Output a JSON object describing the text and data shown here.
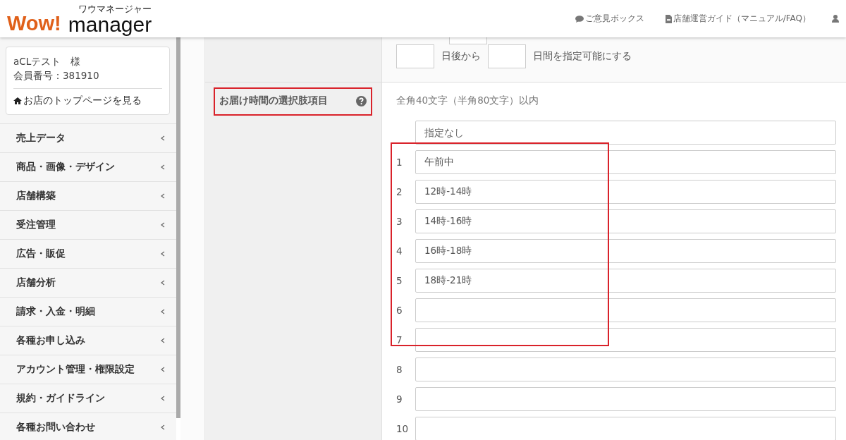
{
  "header": {
    "logo": {
      "brand": "Wow!",
      "name": "manager",
      "ruby": "ワウマネージャー"
    },
    "links": [
      {
        "kind": "feedback",
        "label": "ご意見ボックス"
      },
      {
        "kind": "guide",
        "label": "店舗運営ガイド（マニュアル/FAQ）"
      },
      {
        "kind": "account"
      }
    ]
  },
  "account": {
    "name": "aCLテスト　様",
    "member_no": "会員番号：381910",
    "top_link": "お店のトップページを見る"
  },
  "menu": [
    {
      "label": "売上データ",
      "expanded": false
    },
    {
      "label": "商品・画像・デザイン",
      "expanded": false
    },
    {
      "label": "店舗構築",
      "expanded": false
    },
    {
      "label": "受注管理",
      "expanded": false
    },
    {
      "label": "広告・販促",
      "expanded": false
    },
    {
      "label": "店舗分析",
      "expanded": false
    },
    {
      "label": "請求・入金・明細",
      "expanded": false
    },
    {
      "label": "各種お申し込み",
      "expanded": false
    },
    {
      "label": "アカウント管理・権限設定",
      "expanded": false
    },
    {
      "label": "規約・ガイドライン",
      "expanded": false
    },
    {
      "label": "各種お問い合わせ",
      "expanded": false
    }
  ],
  "days_setting": {
    "after_label": "日後から",
    "range_label": "日間を指定可能にする"
  },
  "time_options": {
    "label": "お届け時間の選択肢項目",
    "hint": "全角40文字（半角80文字）以内",
    "default_placeholder": "指定なし",
    "rows": [
      {
        "number": "1",
        "value": "午前中"
      },
      {
        "number": "2",
        "value": "12時-14時"
      },
      {
        "number": "3",
        "value": "14時-16時"
      },
      {
        "number": "4",
        "value": "16時-18時"
      },
      {
        "number": "5",
        "value": "18時-21時"
      },
      {
        "number": "6",
        "value": ""
      },
      {
        "number": "7",
        "value": ""
      },
      {
        "number": "8",
        "value": ""
      },
      {
        "number": "9",
        "value": ""
      },
      {
        "number": "10",
        "value": ""
      }
    ]
  }
}
